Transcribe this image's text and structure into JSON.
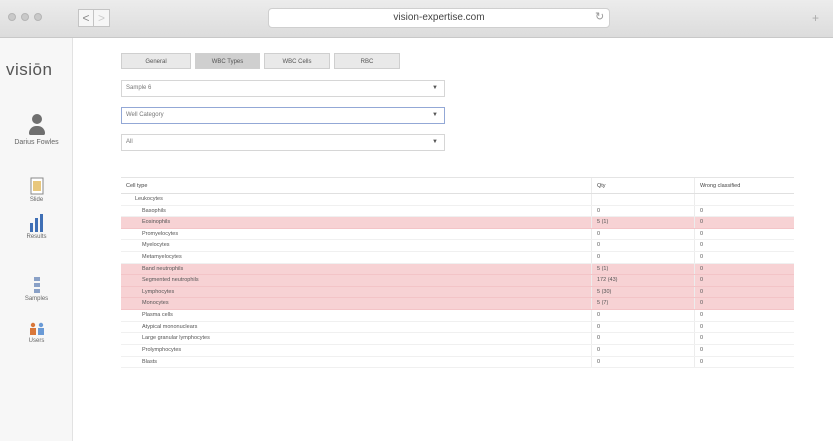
{
  "browser": {
    "url": "vision-expertise.com",
    "back": "<",
    "forward": ">",
    "reload": "↻",
    "new_tab": "+"
  },
  "app": {
    "logo": "visiōn",
    "user_name": "Darius Fowles",
    "nav": [
      {
        "label": "Slide",
        "icon": "slide-icon"
      },
      {
        "label": "Results",
        "icon": "bar-chart-icon"
      },
      {
        "label": "Samples",
        "icon": "samples-icon"
      },
      {
        "label": "Users",
        "icon": "users-icon"
      }
    ]
  },
  "tabs": [
    {
      "label": "General",
      "active": false
    },
    {
      "label": "WBC Types",
      "active": true
    },
    {
      "label": "WBC Cells",
      "active": false
    },
    {
      "label": "RBC",
      "active": false
    }
  ],
  "filters": {
    "sample": "Sample 6",
    "category": "Well Category",
    "scope": "All"
  },
  "table": {
    "headers": [
      "Cell type",
      "Qty",
      "Wrong classified"
    ],
    "group": "Leukocytes",
    "rows": [
      {
        "name": "Basophils",
        "qty": "0",
        "wrong": "0",
        "highlight": false
      },
      {
        "name": "Eosinophils",
        "qty": "5 (1)",
        "wrong": "0",
        "highlight": true
      },
      {
        "name": "Promyelocytes",
        "qty": "0",
        "wrong": "0",
        "highlight": false
      },
      {
        "name": "Myelocytes",
        "qty": "0",
        "wrong": "0",
        "highlight": false
      },
      {
        "name": "Metamyelocytes",
        "qty": "0",
        "wrong": "0",
        "highlight": false
      },
      {
        "name": "Band neutrophils",
        "qty": "5 (1)",
        "wrong": "0",
        "highlight": true
      },
      {
        "name": "Segmented neutrophils",
        "qty": "172 (43)",
        "wrong": "0",
        "highlight": true
      },
      {
        "name": "Lymphocytes",
        "qty": "5 (30)",
        "wrong": "0",
        "highlight": true
      },
      {
        "name": "Monocytes",
        "qty": "5 (7)",
        "wrong": "0",
        "highlight": true
      },
      {
        "name": "Plasma cells",
        "qty": "0",
        "wrong": "0",
        "highlight": false
      },
      {
        "name": "Atypical mononuclears",
        "qty": "0",
        "wrong": "0",
        "highlight": false
      },
      {
        "name": "Large granular lymphocytes",
        "qty": "0",
        "wrong": "0",
        "highlight": false
      },
      {
        "name": "Prolymphocytes",
        "qty": "0",
        "wrong": "0",
        "highlight": false
      },
      {
        "name": "Blasts",
        "qty": "0",
        "wrong": "0",
        "highlight": false
      }
    ]
  }
}
